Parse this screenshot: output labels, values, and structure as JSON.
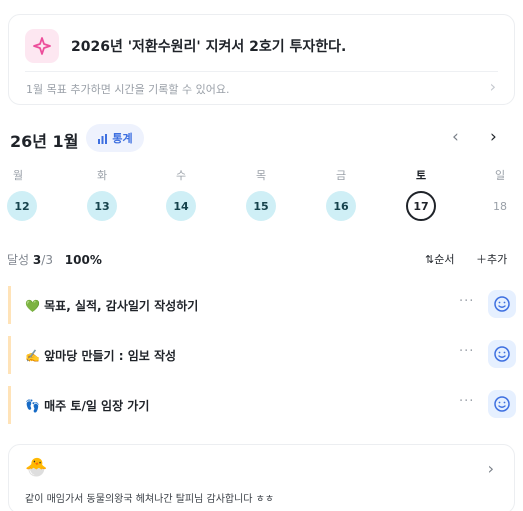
{
  "goal": {
    "title": "2026년 '저환수원리' 지켜서 2호기 투자한다.",
    "subtitle": "1월 목표  추가하면 시간을 기록할 수 있어요.",
    "icon": "sparkle-icon",
    "accent": "#ec4e9b"
  },
  "calendar": {
    "month_label": "26년 1월",
    "stats_label": "통계",
    "weekdays": [
      "월",
      "화",
      "수",
      "목",
      "금",
      "토",
      "일"
    ],
    "days": [
      "12",
      "13",
      "14",
      "15",
      "16",
      "17",
      "18"
    ]
  },
  "progress": {
    "label": "달성",
    "done": "3",
    "total": "/3",
    "percent": "100%",
    "order_label": "순서",
    "add_label": "추가"
  },
  "tasks": [
    {
      "emoji": "💚",
      "title": "목표, 실적, 감사일기 작성하기"
    },
    {
      "emoji": "✍️",
      "title": "앞마당 만들기 : 임보 작성"
    },
    {
      "emoji": "👣",
      "title": "매주 토/일 임장 가기"
    }
  ],
  "gratitude": {
    "emoji": "🐣",
    "text": "같이 매임가서 동물의왕국 헤쳐나간 탈피님 감사합니다 ㅎㅎ"
  },
  "colors": {
    "day_bg": "#cfeff6",
    "stats_blue": "#3d6fe0",
    "task_bar": "#ffe3b8"
  }
}
